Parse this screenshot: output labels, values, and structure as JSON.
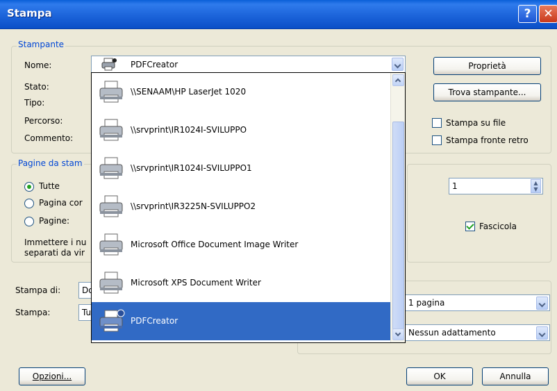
{
  "window": {
    "title": "Stampa"
  },
  "printer_group": {
    "title": "Stampante",
    "name_label": "Nome:",
    "status_label": "Stato:",
    "type_label": "Tipo:",
    "path_label": "Percorso:",
    "comment_label": "Commento:",
    "selected_printer": "PDFCreator",
    "properties_button": "Proprietà",
    "find_printer_button": "Trova stampante...",
    "print_to_file": "Stampa su file",
    "duplex": "Stampa fronte retro"
  },
  "pages_group": {
    "title": "Pagine da stam",
    "all": "Tutte",
    "current_page": "Pagina cor",
    "pages": "Pagine:",
    "hint_line1": "Immettere i nu",
    "hint_line2": "separati da vir"
  },
  "copies": {
    "value": "1",
    "collate": "Fascicola"
  },
  "print_what": {
    "label": "Stampa di:",
    "value": "Do"
  },
  "print_mode": {
    "label": "Stampa:",
    "value": "Tu"
  },
  "zoom": {
    "pages_per_sheet": "1 pagina",
    "scale": "Nessun adattamento"
  },
  "buttons": {
    "options": "Opzioni...",
    "ok": "OK",
    "cancel": "Annulla"
  },
  "printer_list": [
    {
      "name": "\\\\SENAAM\\HP LaserJet 1020"
    },
    {
      "name": "\\\\srvprint\\IR1024I-SVILUPPO"
    },
    {
      "name": "\\\\srvprint\\IR1024I-SVILUPPO1"
    },
    {
      "name": "\\\\srvprint\\IR3225N-SVILUPPO2"
    },
    {
      "name": "Microsoft Office Document Image Writer"
    },
    {
      "name": "Microsoft XPS Document Writer"
    },
    {
      "name": "PDFCreator"
    }
  ],
  "colors": {
    "accent": "#316ac5",
    "group_title": "#0046d5",
    "check": "#21a121"
  }
}
